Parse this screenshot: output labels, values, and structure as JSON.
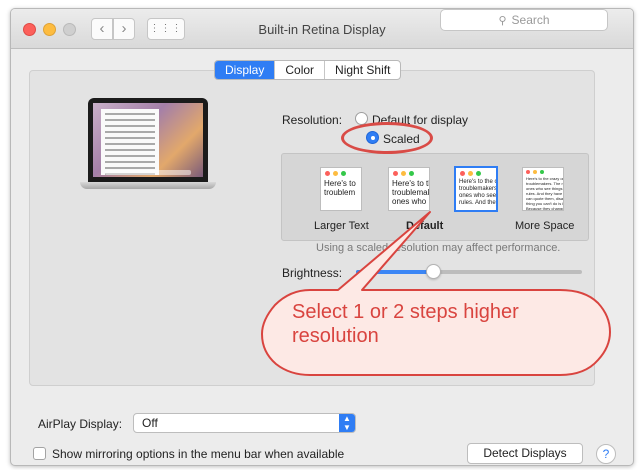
{
  "window": {
    "title": "Built-in Retina Display",
    "search_placeholder": "Search",
    "nav_back": "‹",
    "nav_forward": "›",
    "grid": "⋮⋮⋮"
  },
  "tabs": [
    {
      "label": "Display",
      "active": true
    },
    {
      "label": "Color",
      "active": false
    },
    {
      "label": "Night Shift",
      "active": false
    }
  ],
  "resolution": {
    "label": "Resolution:",
    "options": [
      {
        "label": "Default for display",
        "checked": false
      },
      {
        "label": "Scaled",
        "checked": true
      }
    ]
  },
  "scaled_options": [
    {
      "label": "Larger Text",
      "thumb_lines": [
        "Here's to",
        "troublem"
      ],
      "selected": false,
      "bold": false
    },
    {
      "label": "",
      "thumb_lines": [
        "Here's to th",
        "troublemak",
        "ones who i"
      ],
      "selected": false,
      "bold": false
    },
    {
      "label": "Default",
      "thumb_lines": [
        "Here's to the c",
        "troublemakers,",
        "ones who see t",
        "rules. And they"
      ],
      "selected": true,
      "bold": true
    },
    {
      "label": "More Space",
      "thumb_lines": [
        "Here's to the crazy one",
        "troublemakers. The rou",
        "ones who see things di",
        "rules. And they have no",
        "can quote them, disagr",
        "thing you can't do is ig",
        "Because they change th"
      ],
      "selected": false,
      "bold": false
    }
  ],
  "scaled_note": "Using a scaled resolution may affect performance.",
  "brightness": {
    "label": "Brightness:",
    "level": 0.34
  },
  "callout": {
    "text": "Select 1 or 2 steps higher resolution"
  },
  "airplay": {
    "label": "AirPlay Display:",
    "selected": "Off"
  },
  "mirroring": {
    "label": "Show mirroring options in the menu bar when available",
    "checked": false
  },
  "detect_button": "Detect Displays",
  "help_button": "?",
  "colors": {
    "accent": "#2f7df4",
    "callout_red": "#d9443f",
    "callout_fill": "#fde9e5"
  }
}
